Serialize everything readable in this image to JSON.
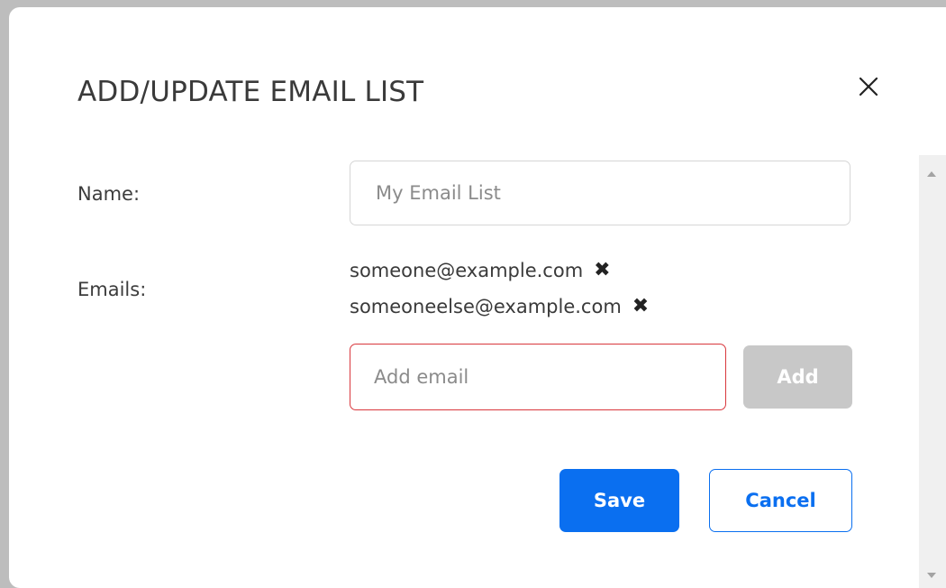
{
  "dialog": {
    "title": "ADD/UPDATE EMAIL LIST",
    "close_icon": "close-icon"
  },
  "form": {
    "name_label": "Name:",
    "name_placeholder": "My Email List",
    "name_value": "",
    "emails_label": "Emails:",
    "emails": [
      "someone@example.com",
      "someoneelse@example.com"
    ],
    "remove_icon": "x-mark-icon",
    "add_email_placeholder": "Add email",
    "add_email_value": "",
    "add_button_label": "Add"
  },
  "actions": {
    "save_label": "Save",
    "cancel_label": "Cancel"
  },
  "colors": {
    "primary": "#0a6ff0",
    "error_border": "#d9373d",
    "disabled": "#c8c8c8"
  }
}
